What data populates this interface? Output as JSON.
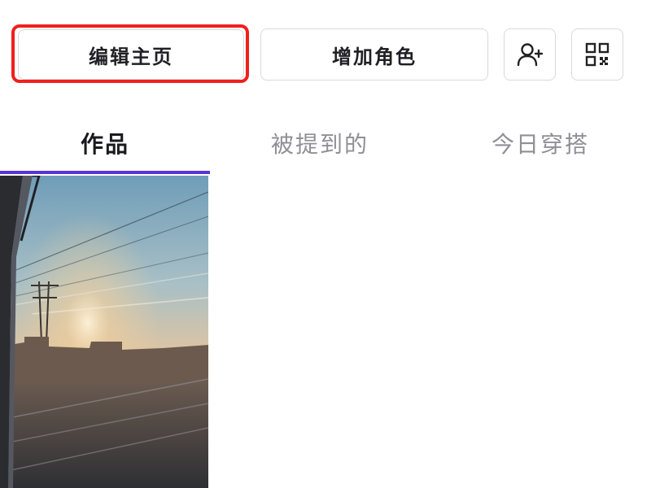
{
  "actions": {
    "edit_profile_label": "编辑主页",
    "add_role_label": "增加角色",
    "add_friend_icon": "add-user-icon",
    "qr_icon": "qr-code-icon"
  },
  "tabs": [
    {
      "label": "作品",
      "active": true
    },
    {
      "label": "被提到的",
      "active": false
    },
    {
      "label": "今日穿搭",
      "active": false
    }
  ],
  "colors": {
    "highlight": "#f0201c",
    "tab_indicator": "#5a33d6",
    "active_text": "#1a1a1f",
    "inactive_text": "#8f8f96"
  },
  "works": [
    {
      "thumbnail": "train-window-sunset"
    }
  ]
}
